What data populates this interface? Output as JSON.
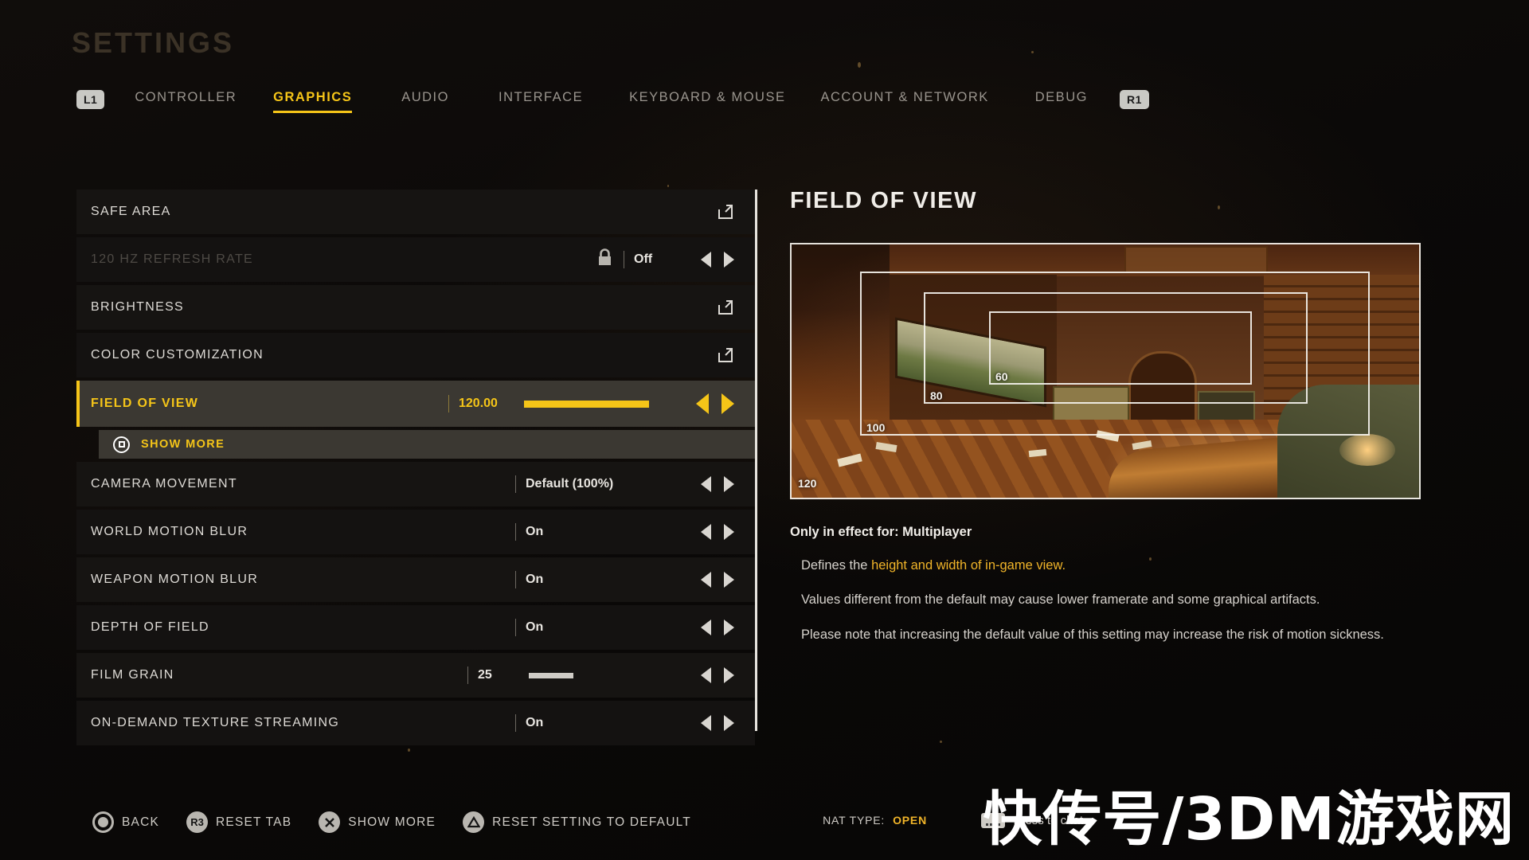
{
  "header": {
    "title": "SETTINGS",
    "left_bumper": "L1",
    "right_bumper": "R1",
    "tabs": [
      {
        "label": "CONTROLLER",
        "active": false
      },
      {
        "label": "GRAPHICS",
        "active": true
      },
      {
        "label": "AUDIO",
        "active": false
      },
      {
        "label": "INTERFACE",
        "active": false
      },
      {
        "label": "KEYBOARD & MOUSE",
        "active": false
      },
      {
        "label": "ACCOUNT & NETWORK",
        "active": false
      },
      {
        "label": "DEBUG",
        "active": false
      }
    ]
  },
  "settings": {
    "rows": [
      {
        "label": "SAFE AREA",
        "type": "link",
        "value": "",
        "icon": "external-link-icon"
      },
      {
        "label": "120 HZ REFRESH RATE",
        "type": "stepper",
        "value": "Off",
        "disabled": true,
        "icon": "lock-icon"
      },
      {
        "label": "BRIGHTNESS",
        "type": "link",
        "value": "",
        "icon": "external-link-icon"
      },
      {
        "label": "COLOR CUSTOMIZATION",
        "type": "link",
        "value": "",
        "icon": "external-link-icon"
      },
      {
        "label": "FIELD OF VIEW",
        "type": "slider",
        "value": "120.00",
        "selected": true,
        "fill_percent": 80
      },
      {
        "label": "CAMERA MOVEMENT",
        "type": "stepper",
        "value": "Default (100%)"
      },
      {
        "label": "WORLD MOTION BLUR",
        "type": "stepper",
        "value": "On"
      },
      {
        "label": "WEAPON MOTION BLUR",
        "type": "stepper",
        "value": "On"
      },
      {
        "label": "DEPTH OF FIELD",
        "type": "stepper",
        "value": "On"
      },
      {
        "label": "FILM GRAIN",
        "type": "slider-grey",
        "value": "25",
        "fill_percent": 25
      },
      {
        "label": "ON-DEMAND TEXTURE STREAMING",
        "type": "stepper",
        "value": "On"
      }
    ],
    "show_more": {
      "label": "SHOW MORE",
      "button_glyph": "ps-square-button-icon"
    }
  },
  "detail": {
    "title": "FIELD OF VIEW",
    "preview": {
      "fov_labels": [
        "60",
        "80",
        "100",
        "120"
      ]
    },
    "effect_line": "Only in effect for: Multiplayer",
    "description_1_prefix": "Defines the ",
    "description_1_highlight": "height and width of in-game view.",
    "description_2": "Values different from the default may cause lower framerate and some graphical artifacts.",
    "description_3": "Please note that increasing the default value of this setting may increase the risk of motion sickness."
  },
  "bottombar": {
    "actions": [
      {
        "glyph": "circle-button-icon",
        "label": "BACK"
      },
      {
        "glyph": "r3-button-icon",
        "label": "RESET TAB"
      },
      {
        "glyph": "cross-button-icon",
        "label": "SHOW MORE"
      },
      {
        "glyph": "triangle-button-icon",
        "label": "RESET SETTING TO DEFAULT"
      }
    ],
    "r3_text": "R3",
    "nat_label": "NAT TYPE:",
    "nat_value": "OPEN",
    "chat_hint": "Press to chat"
  },
  "watermark": {
    "text": "快传号/3DM游戏网"
  },
  "colors": {
    "accent": "#f5c518",
    "accent_soft": "#f0b429",
    "row_bg": "#161412",
    "row_selected_bg": "#3b3832",
    "text": "#dedbd6",
    "text_dim": "#4e4a45",
    "background": "#0a0807"
  }
}
